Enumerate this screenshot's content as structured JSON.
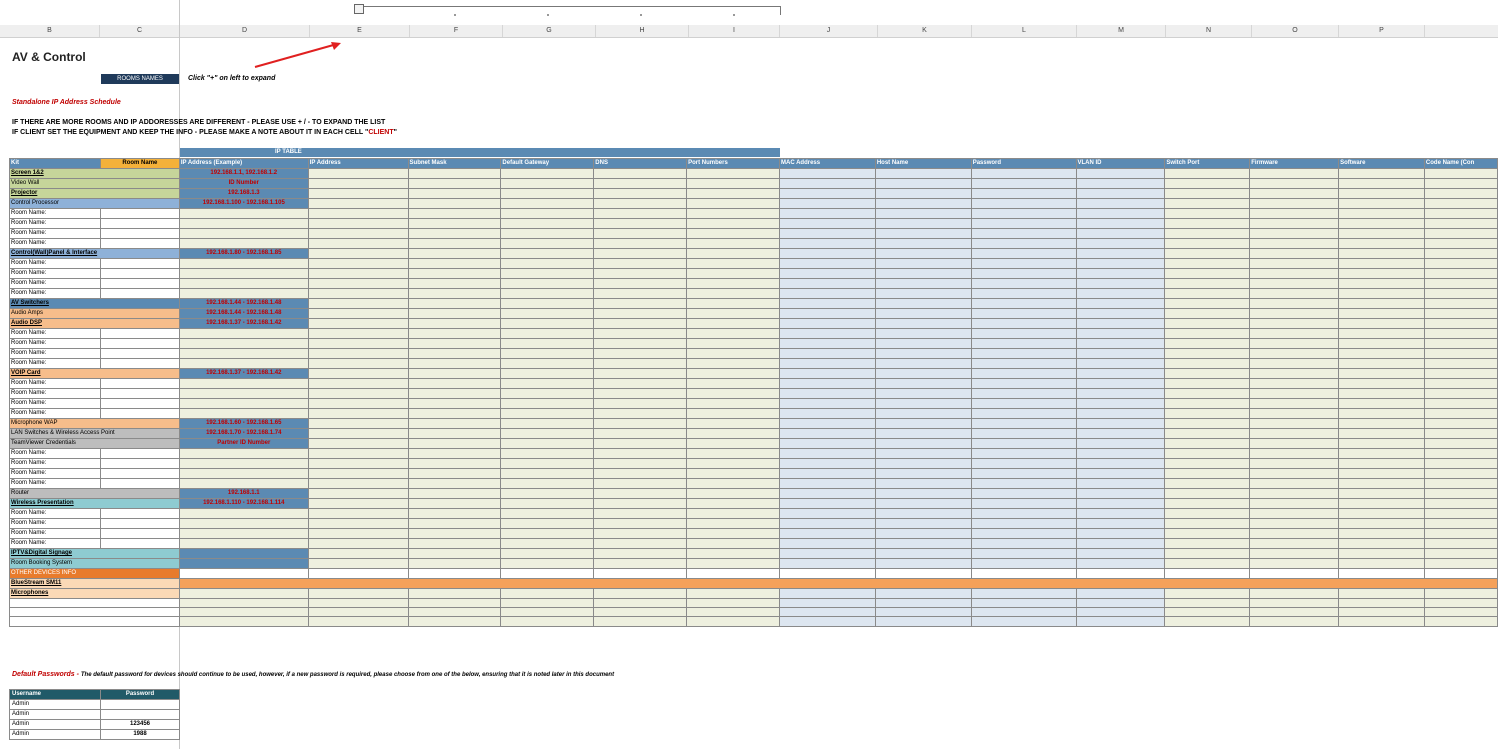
{
  "column_headers": [
    "B",
    "C",
    "D",
    "E",
    "F",
    "G",
    "H",
    "I",
    "J",
    "K",
    "L",
    "M",
    "N",
    "O",
    "P"
  ],
  "sheet": {
    "title": "AV & Control",
    "rooms_button": "ROOMS NAMES",
    "hint": "Click \"+\" on left to expand",
    "standalone_title": "Standalone IP Address Schedule",
    "instruction_1": "IF THERE ARE MORE ROOMS AND IP ADDORESSES ARE DIFFERENT - PLEASE USE + / - TO EXPAND THE LIST",
    "instruction_2a": "IF CLIENT SET THE EQUIPMENT AND KEEP THE INFO - PLEASE MAKE A NOTE ABOUT IT IN EACH CELL \"",
    "instruction_2b": "CLIENT",
    "instruction_2c": "\"",
    "ip_table_label": "IP TABLE"
  },
  "grid": {
    "headers": [
      "Kit",
      "Room Name",
      "IP Address (Example)",
      "IP Address",
      "Subnet Mask",
      "Default Gateway",
      "DNS",
      "Port Numbers",
      "MAC Address",
      "Host Name",
      "Password",
      "VLAN ID",
      "Switch Port",
      "Firmware",
      "Software",
      "Code Name (Con"
    ],
    "rows": [
      {
        "kit": "Screen 1&2",
        "ip": "192.168.1.1, 192.168.1.2",
        "style": "c-green",
        "span": true,
        "bold": true
      },
      {
        "kit": "Video Wall",
        "ip": "ID Number",
        "style": "c-green",
        "span": true
      },
      {
        "kit": "Projector",
        "ip": "192.168.1.3",
        "style": "c-green",
        "span": true,
        "bold": true
      },
      {
        "kit": "Control Processor",
        "ip": "192.168.1.100 - 192.168.1.105",
        "style": "c-blue",
        "span": true
      },
      {
        "kit": "Room Name:",
        "ip": "",
        "style": "wht"
      },
      {
        "kit": "Room Name:",
        "ip": "",
        "style": "wht"
      },
      {
        "kit": "Room Name:",
        "ip": "",
        "style": "wht"
      },
      {
        "kit": "Room Name:",
        "ip": "",
        "style": "wht"
      },
      {
        "kit": "Control(Wall)Panel & Interface",
        "ip": "192.168.1.80 - 192.168.1.85",
        "style": "c-blue",
        "span": true,
        "bold": true
      },
      {
        "kit": "Room Name:",
        "ip": "",
        "style": "wht"
      },
      {
        "kit": "Room Name:",
        "ip": "",
        "style": "wht"
      },
      {
        "kit": "Room Name:",
        "ip": "",
        "style": "wht"
      },
      {
        "kit": "Room Name:",
        "ip": "",
        "style": "wht"
      },
      {
        "kit": "AV Switchers",
        "ip": "192.168.1.44 - 192.168.1.48",
        "style": "c-steel",
        "span": true,
        "bold": true
      },
      {
        "kit": "Audio Amps",
        "ip": "192.168.1.44 - 192.168.1.48",
        "style": "c-orange",
        "span": true
      },
      {
        "kit": "Audio DSP",
        "ip": "192.168.1.37 - 192.168.1.42",
        "style": "c-orange",
        "span": true,
        "bold": true
      },
      {
        "kit": "Room Name:",
        "ip": "",
        "style": "wht"
      },
      {
        "kit": "Room Name:",
        "ip": "",
        "style": "wht"
      },
      {
        "kit": "Room Name:",
        "ip": "",
        "style": "wht"
      },
      {
        "kit": "Room Name:",
        "ip": "",
        "style": "wht"
      },
      {
        "kit": "VOIP Card",
        "ip": "192.168.1.37 - 192.168.1.42",
        "style": "c-orange",
        "span": true,
        "bold": true
      },
      {
        "kit": "Room Name:",
        "ip": "",
        "style": "wht"
      },
      {
        "kit": "Room Name:",
        "ip": "",
        "style": "wht"
      },
      {
        "kit": "Room Name:",
        "ip": "",
        "style": "wht"
      },
      {
        "kit": "Room Name:",
        "ip": "",
        "style": "wht"
      },
      {
        "kit": "Microphone WAP",
        "ip": "192.168.1.60 - 192.168.1.65",
        "style": "c-orange",
        "span": true
      },
      {
        "kit": "LAN Switches & Wireless Access Point",
        "ip": "192.168.1.70 - 192.168.1.74",
        "style": "c-grey",
        "span": true
      },
      {
        "kit": "TeamViewer Credentials",
        "ip": "Partner ID Number",
        "style": "c-grey",
        "span": true
      },
      {
        "kit": "Room Name:",
        "ip": "",
        "style": "wht"
      },
      {
        "kit": "Room Name:",
        "ip": "",
        "style": "wht"
      },
      {
        "kit": "Room Name:",
        "ip": "",
        "style": "wht"
      },
      {
        "kit": "Room Name:",
        "ip": "",
        "style": "wht"
      },
      {
        "kit": "Router",
        "ip": "192.168.1.1",
        "style": "c-grey",
        "span": true
      },
      {
        "kit": "Wireless Presentation",
        "ip": "192.168.1.110 - 192.168.1.114",
        "style": "c-teal",
        "span": true,
        "bold": true
      },
      {
        "kit": "Room Name:",
        "ip": "",
        "style": "wht"
      },
      {
        "kit": "Room Name:",
        "ip": "",
        "style": "wht"
      },
      {
        "kit": "Room Name:",
        "ip": "",
        "style": "wht"
      },
      {
        "kit": "Room Name:",
        "ip": "",
        "style": "wht"
      },
      {
        "kit": "IPTV&Digital Signage",
        "ip": "",
        "style": "c-teal",
        "span": true,
        "bold": true
      },
      {
        "kit": "Room Booking System",
        "ip": "",
        "style": "c-teal",
        "span": true
      },
      {
        "kit": "OTHER DEVICES INFO",
        "ip": "",
        "style": "c-darkorange",
        "span": true
      },
      {
        "kit": "BlueStream SM11",
        "ip": "",
        "style": "c-peach",
        "span": true,
        "bold": true,
        "bar": true
      },
      {
        "kit": "Microphones",
        "ip": "",
        "style": "c-peach",
        "span": true,
        "bold": true
      },
      {
        "kit": "",
        "ip": "",
        "style": "wht",
        "span": true
      },
      {
        "kit": "",
        "ip": "",
        "style": "wht",
        "span": true
      },
      {
        "kit": "",
        "ip": "",
        "style": "wht",
        "span": true
      }
    ]
  },
  "passwords": {
    "label": "Default Passwords -",
    "note": "The default password for devices should continue to be used, however, if a new password is required, please choose from one of the below, ensuring that it is noted later in this document",
    "headers": [
      "Username",
      "Password"
    ],
    "rows": [
      {
        "user": "Admin",
        "pass": ""
      },
      {
        "user": "Admin",
        "pass": ""
      },
      {
        "user": "Admin",
        "pass": "123456"
      },
      {
        "user": "Admin",
        "pass": "1988"
      }
    ]
  },
  "colors": {
    "accent_blue": "#5b8ab3",
    "room_name_orange": "#f4b13a",
    "red_text": "#c00000",
    "arrow": "#e02020"
  }
}
